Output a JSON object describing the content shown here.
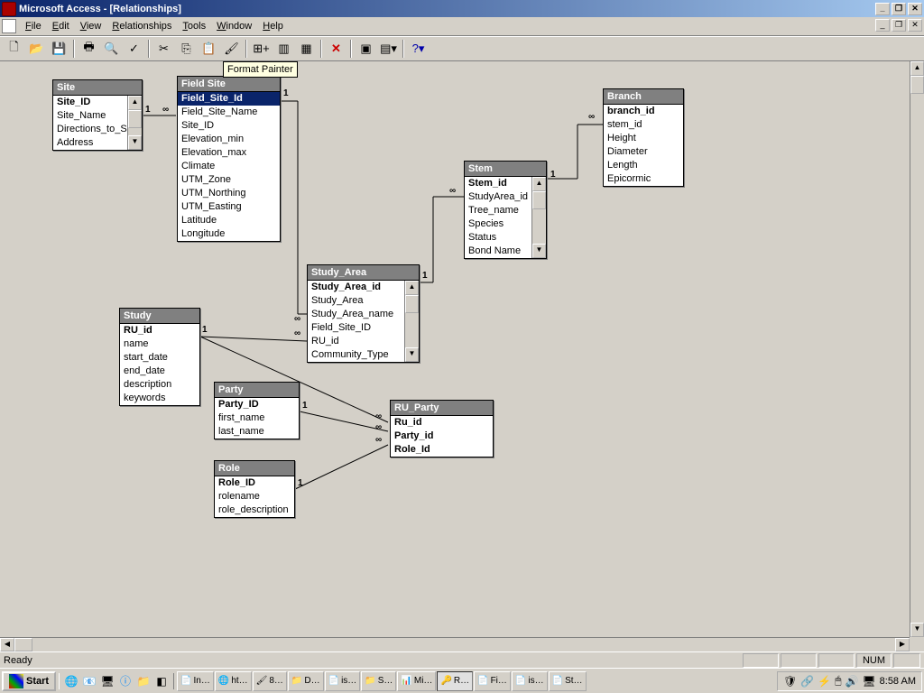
{
  "window": {
    "title": "Microsoft Access - [Relationships]"
  },
  "menu": {
    "file": "File",
    "edit": "Edit",
    "view": "View",
    "relationships": "Relationships",
    "tools": "Tools",
    "window": "Window",
    "help": "Help"
  },
  "tooltip": "Format Painter",
  "tables": {
    "site": {
      "title": "Site",
      "fields": [
        "Site_ID",
        "Site_Name",
        "Directions_to_Si",
        "Address"
      ],
      "has_scroll": true
    },
    "field_site": {
      "title": "Field Site",
      "fields": [
        "Field_Site_Id",
        "Field_Site_Name",
        "Site_ID",
        "Elevation_min",
        "Elevation_max",
        "Climate",
        "UTM_Zone",
        "UTM_Northing",
        "UTM_Easting",
        "Latitude",
        "Longitude"
      ],
      "selected": 0
    },
    "study_area": {
      "title": "Study_Area",
      "fields": [
        "Study_Area_id",
        "Study_Area",
        "Study_Area_name",
        "Field_Site_ID",
        "RU_id",
        "Community_Type"
      ],
      "has_scroll": true
    },
    "stem": {
      "title": "Stem",
      "fields": [
        "Stem_id",
        "StudyArea_id",
        "Tree_name",
        "Species",
        "Status",
        "Bond Name"
      ],
      "has_scroll": true
    },
    "branch": {
      "title": "Branch",
      "fields": [
        "branch_id",
        "stem_id",
        "Height",
        "Diameter",
        "Length",
        "Epicormic"
      ]
    },
    "study": {
      "title": "Study",
      "fields": [
        "RU_id",
        "name",
        "start_date",
        "end_date",
        "description",
        "keywords"
      ]
    },
    "party": {
      "title": "Party",
      "fields": [
        "Party_ID",
        "first_name",
        "last_name"
      ]
    },
    "role": {
      "title": "Role",
      "fields": [
        "Role_ID",
        "rolename",
        "role_description"
      ]
    },
    "ru_party": {
      "title": "RU_Party",
      "fields": [
        "Ru_id",
        "Party_id",
        "Role_Id"
      ]
    }
  },
  "labels": {
    "one": "1",
    "inf": "∞"
  },
  "status": {
    "ready": "Ready",
    "num": "NUM"
  },
  "taskbar": {
    "start": "Start",
    "tasks": [
      "In…",
      "ht…",
      "8…",
      "D…",
      "is…",
      "S…",
      "Mi…",
      "R…",
      "Fi…",
      "is…",
      "St…"
    ],
    "active": 7,
    "time": "8:58 AM"
  }
}
